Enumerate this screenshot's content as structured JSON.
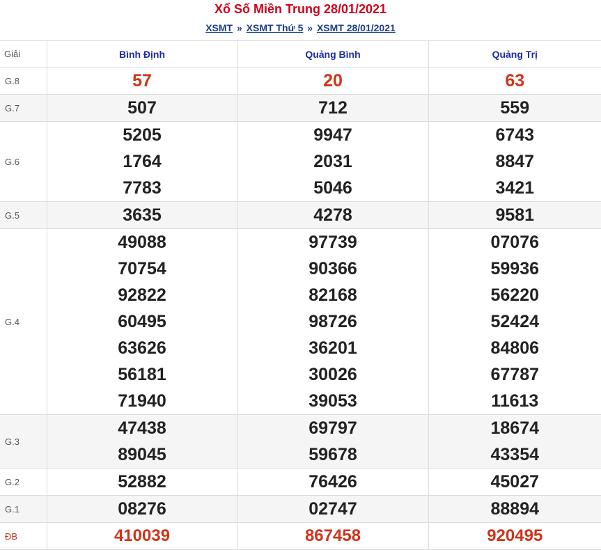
{
  "header": {
    "title": "Xổ Số Miền Trung 28/01/2021",
    "breadcrumb": [
      {
        "label": "XSMT"
      },
      {
        "label": "XSMT Thứ 5"
      },
      {
        "label": "XSMT 28/01/2021"
      }
    ],
    "separator": "»"
  },
  "table": {
    "label_header": "Giải",
    "provinces": [
      "Bình Định",
      "Quảng Bình",
      "Quảng Trị"
    ],
    "rows": [
      {
        "prize": "G.8",
        "style": "red",
        "values": [
          [
            "57"
          ],
          [
            "20"
          ],
          [
            "63"
          ]
        ]
      },
      {
        "prize": "G.7",
        "style": "normal",
        "values": [
          [
            "507"
          ],
          [
            "712"
          ],
          [
            "559"
          ]
        ]
      },
      {
        "prize": "G.6",
        "style": "normal",
        "values": [
          [
            "5205",
            "1764",
            "7783"
          ],
          [
            "9947",
            "2031",
            "5046"
          ],
          [
            "6743",
            "8847",
            "3421"
          ]
        ]
      },
      {
        "prize": "G.5",
        "style": "normal",
        "values": [
          [
            "3635"
          ],
          [
            "4278"
          ],
          [
            "9581"
          ]
        ]
      },
      {
        "prize": "G.4",
        "style": "normal",
        "values": [
          [
            "49088",
            "70754",
            "92822",
            "60495",
            "63626",
            "56181",
            "71940"
          ],
          [
            "97739",
            "90366",
            "82168",
            "98726",
            "36201",
            "30026",
            "39053"
          ],
          [
            "07076",
            "59936",
            "56220",
            "52424",
            "84806",
            "67787",
            "11613"
          ]
        ]
      },
      {
        "prize": "G.3",
        "style": "normal",
        "values": [
          [
            "47438",
            "89045"
          ],
          [
            "69797",
            "59678"
          ],
          [
            "18674",
            "43354"
          ]
        ]
      },
      {
        "prize": "G.2",
        "style": "normal",
        "values": [
          [
            "52882"
          ],
          [
            "76426"
          ],
          [
            "45027"
          ]
        ]
      },
      {
        "prize": "G.1",
        "style": "normal",
        "values": [
          [
            "08276"
          ],
          [
            "02747"
          ],
          [
            "88894"
          ]
        ]
      },
      {
        "prize": "ĐB",
        "style": "red",
        "values": [
          [
            "410039"
          ],
          [
            "867458"
          ],
          [
            "920495"
          ]
        ]
      }
    ]
  }
}
